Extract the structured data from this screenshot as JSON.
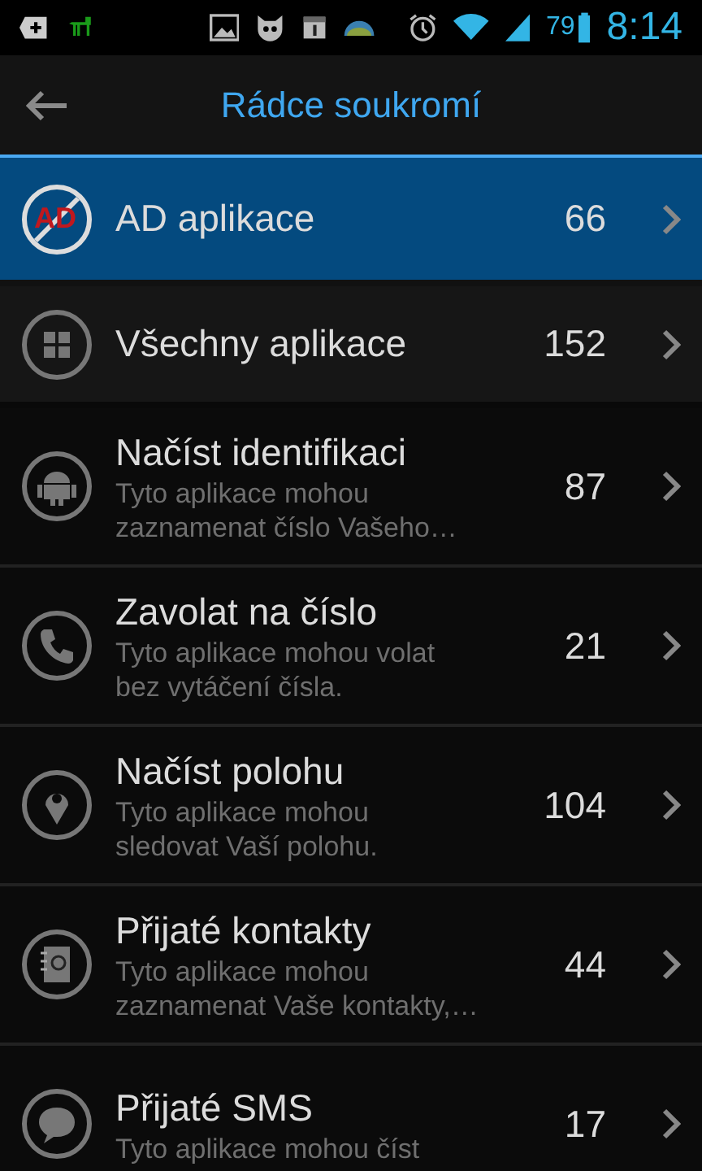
{
  "status_bar": {
    "battery": "79",
    "time": "8:14"
  },
  "header": {
    "title": "Rádce soukromí"
  },
  "top_items": [
    {
      "kind": "no-ad",
      "badge_text": "AD",
      "label": "AD aplikace",
      "count": "66",
      "selected": true
    },
    {
      "kind": "grid",
      "label": "Všechny aplikace",
      "count": "152",
      "selected": false
    }
  ],
  "permissions": [
    {
      "kind": "android",
      "title": "Načíst identifikaci",
      "description": "Tyto aplikace mohou\nzaznamenat číslo Vašeho…",
      "count": "87"
    },
    {
      "kind": "phone",
      "title": "Zavolat na číslo",
      "description": "Tyto aplikace mohou volat\nbez vytáčení čísla.",
      "count": "21"
    },
    {
      "kind": "pin",
      "title": "Načíst polohu",
      "description": "Tyto aplikace mohou\nsledovat Vaší polohu.",
      "count": "104"
    },
    {
      "kind": "contacts",
      "title": "Přijaté kontakty",
      "description": "Tyto aplikace mohou\nzaznamenat Vaše kontakty,…",
      "count": "44"
    },
    {
      "kind": "chat",
      "title": "Přijaté SMS",
      "description": "Tyto aplikace mohou číst",
      "count": "17"
    }
  ]
}
